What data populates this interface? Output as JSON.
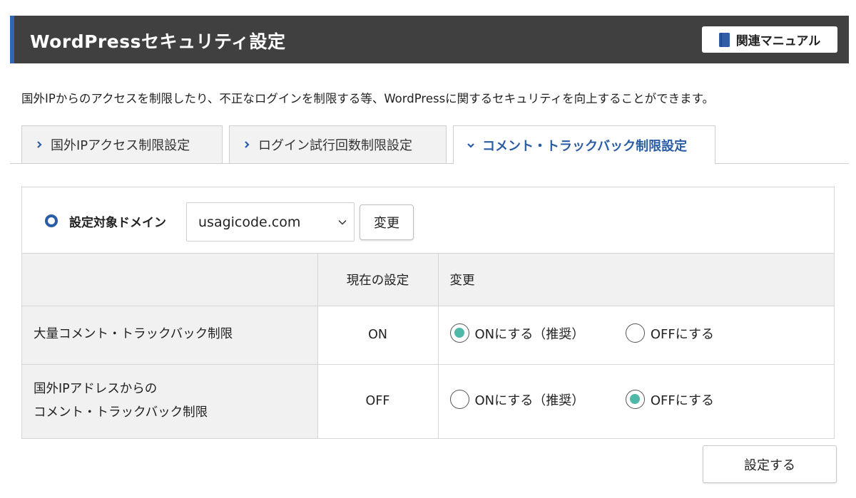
{
  "header": {
    "title": "WordPressセキュリティ設定",
    "manual_label": "関連マニュアル",
    "manual_icon": "book-icon",
    "accent_color": "#2f67b3",
    "bg_color": "#404040"
  },
  "description": "国外IPからのアクセスを制限したり、不正なログインを制限する等、WordPressに関するセキュリティを向上することができます。",
  "tabs": [
    {
      "label": "国外IPアクセス制限設定",
      "active": false,
      "icon": "chevron-right-icon"
    },
    {
      "label": "ログイン試行回数制限設定",
      "active": false,
      "icon": "chevron-right-icon"
    },
    {
      "label": "コメント・トラックバック制限設定",
      "active": true,
      "icon": "chevron-down-icon"
    }
  ],
  "domain": {
    "label": "設定対象ドメイン",
    "selected": "usagicode.com",
    "change_label": "変更"
  },
  "table": {
    "headers": [
      "",
      "現在の設定",
      "変更"
    ],
    "rows": [
      {
        "name_lines": [
          "大量コメント・トラックバック制限"
        ],
        "current": "ON",
        "options": [
          {
            "label": "ONにする（推奨）",
            "checked": true
          },
          {
            "label": "OFFにする",
            "checked": false
          }
        ]
      },
      {
        "name_lines": [
          "国外IPアドレスからの",
          "コメント・トラックバック制限"
        ],
        "current": "OFF",
        "options": [
          {
            "label": "ONにする（推奨）",
            "checked": false
          },
          {
            "label": "OFFにする",
            "checked": true
          }
        ]
      }
    ]
  },
  "submit_label": "設定する",
  "colors": {
    "radio_checked": "#4fb8a9",
    "active_tab_text": "#2b5ca6"
  }
}
